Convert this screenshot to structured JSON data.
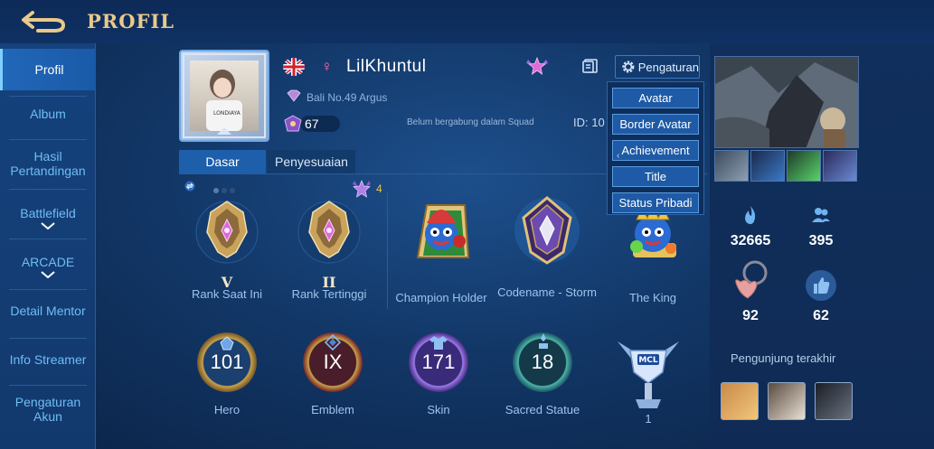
{
  "header": {
    "title": "PROFIL"
  },
  "sidebar": {
    "items": [
      {
        "label": "Profil"
      },
      {
        "label": "Album"
      },
      {
        "label": "Hasil Pertandingan"
      },
      {
        "label": "Battlefield"
      },
      {
        "label": "ARCADE"
      },
      {
        "label": "Detail Mentor"
      },
      {
        "label": "Info Streamer"
      },
      {
        "label": "Pengaturan Akun"
      }
    ]
  },
  "profile": {
    "username": "LilKhuntul",
    "server": "Bali No.49 Argus",
    "level": "67",
    "squad": "Belum bergabung dalam Squad",
    "id": "ID: 10",
    "settings_label": "Pengaturan"
  },
  "dropdown": {
    "items": [
      "Avatar",
      "Border Avatar",
      "Achievement",
      "Title",
      "Status Pribadi"
    ]
  },
  "tabs": [
    "Dasar",
    "Penyesuaian"
  ],
  "star_count": "4",
  "achievements": [
    {
      "label": "Rank Saat Ini",
      "roman": "V"
    },
    {
      "label": "Rank Tertinggi",
      "roman": "II"
    },
    {
      "label": "Champion Holder"
    },
    {
      "label": "Codename - Storm"
    },
    {
      "label": "The King"
    }
  ],
  "stats": [
    {
      "label": "Hero",
      "value": "101"
    },
    {
      "label": "Emblem",
      "value": "IX"
    },
    {
      "label": "Skin",
      "value": "171"
    },
    {
      "label": "Sacred Statue",
      "value": "18"
    },
    {
      "label": "1"
    }
  ],
  "right": {
    "popularity": "32665",
    "friends": "395",
    "bonds": "92",
    "likes": "62",
    "visitors_label": "Pengunjung terakhir"
  },
  "colors": {
    "accent_gold": "#e9c98a",
    "sidebar_active": "#2167b8",
    "text_blue": "#6fbdf5"
  }
}
